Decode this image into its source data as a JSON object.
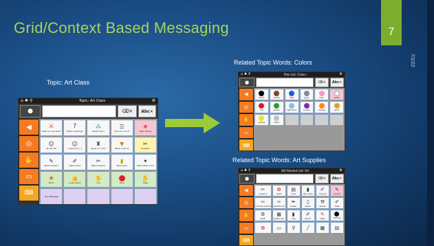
{
  "slide": {
    "title": "Grid/Context Based Messaging",
    "number": "7",
    "date": "7/1/22"
  },
  "labels": {
    "art_class": "Topic:  Art Class",
    "colors": "Related Topic Words: Colors",
    "supplies": "Related Topic Words: Art Supplies"
  },
  "main_device": {
    "title": "Topic: Art Class",
    "speak_label": "Speak",
    "clear_label": "Clear",
    "delete_label": "Delete",
    "side_buttons": [
      "Speak",
      "Core Words",
      "Quick Words",
      "Feelings",
      "Keyboard"
    ],
    "rows": [
      [
        "What do we need?",
        "What's starting?",
        "What color?",
        "How do I do it?",
        "Topic Words"
      ],
      [
        "No art lab",
        "I need my [...]",
        "Spray on color",
        "Want crayons",
        "Supplies"
      ],
      [
        "Want markers",
        "Want paint",
        "Need scissors",
        "Need glue",
        "Want other color"
      ],
      [
        "More",
        "Looks good",
        "I do",
        "Stop",
        "Help"
      ],
      [
        "Your Message",
        "",
        "",
        "",
        ""
      ]
    ]
  },
  "colors_device": {
    "title": "Plan List: Colors",
    "cells": [
      "black",
      "brown",
      "blue",
      "gray",
      "pink",
      "white",
      "red",
      "green",
      "light blue",
      "purple",
      "orange",
      "gold",
      "yellow",
      "silver",
      "",
      "",
      "",
      ""
    ]
  },
  "supplies_device": {
    "title": "[W] Related List: Art",
    "cells": [
      "scissors",
      "paint",
      "ruler",
      "glue stick",
      "crayons",
      "marker",
      "colored pencils",
      "paintbrush",
      "eraser",
      "paper",
      "stamp",
      "chalk",
      "easel",
      "watercolor",
      "clay",
      "pencil",
      "tape",
      "stickers"
    ]
  }
}
